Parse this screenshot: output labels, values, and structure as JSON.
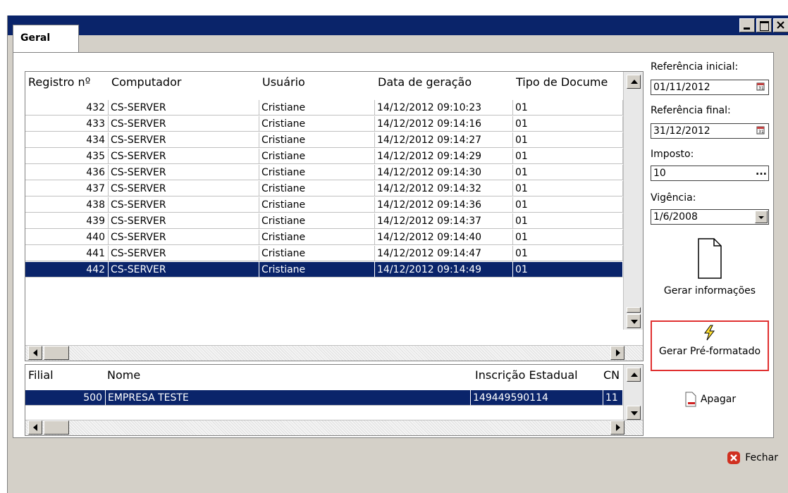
{
  "window": {
    "title": "",
    "buttons": [
      "minimize",
      "maximize",
      "close"
    ]
  },
  "tabs": [
    {
      "label": "Geral"
    }
  ],
  "main_grid": {
    "columns": [
      "Registro nº",
      "Computador",
      "Usuário",
      "Data de geração",
      "Tipo de Docume"
    ],
    "rows": [
      [
        "432",
        "CS-SERVER",
        "Cristiane",
        "14/12/2012 09:10:23",
        "01"
      ],
      [
        "433",
        "CS-SERVER",
        "Cristiane",
        "14/12/2012 09:14:16",
        "01"
      ],
      [
        "434",
        "CS-SERVER",
        "Cristiane",
        "14/12/2012 09:14:27",
        "01"
      ],
      [
        "435",
        "CS-SERVER",
        "Cristiane",
        "14/12/2012 09:14:29",
        "01"
      ],
      [
        "436",
        "CS-SERVER",
        "Cristiane",
        "14/12/2012 09:14:30",
        "01"
      ],
      [
        "437",
        "CS-SERVER",
        "Cristiane",
        "14/12/2012 09:14:32",
        "01"
      ],
      [
        "438",
        "CS-SERVER",
        "Cristiane",
        "14/12/2012 09:14:36",
        "01"
      ],
      [
        "439",
        "CS-SERVER",
        "Cristiane",
        "14/12/2012 09:14:37",
        "01"
      ],
      [
        "440",
        "CS-SERVER",
        "Cristiane",
        "14/12/2012 09:14:40",
        "01"
      ],
      [
        "441",
        "CS-SERVER",
        "Cristiane",
        "14/12/2012 09:14:47",
        "01"
      ],
      [
        "442",
        "CS-SERVER",
        "Cristiane",
        "14/12/2012 09:14:49",
        "01"
      ]
    ],
    "selected_row": 10
  },
  "branch_grid": {
    "columns": [
      "Filial",
      "Nome",
      "Inscrição Estadual",
      "CN"
    ],
    "rows": [
      [
        "500",
        "EMPRESA TESTE",
        "149449590114",
        "11"
      ]
    ],
    "selected_row": 0
  },
  "side": {
    "ref_inicial_label": "Referência inicial:",
    "ref_inicial_value": "01/11/2012",
    "ref_final_label": "Referência final:",
    "ref_final_value": "31/12/2012",
    "imposto_label": "Imposto:",
    "imposto_value": "10",
    "imposto_button": "...",
    "vigencia_label": "Vigência:",
    "vigencia_value": "1/6/2008",
    "gerar_info_label": "Gerar informações",
    "gerar_pre_label": "Gerar Pré-formatado",
    "apagar_label": "Apagar",
    "highlight_color": "#e03030"
  },
  "footer": {
    "fechar_label": "Fechar"
  }
}
